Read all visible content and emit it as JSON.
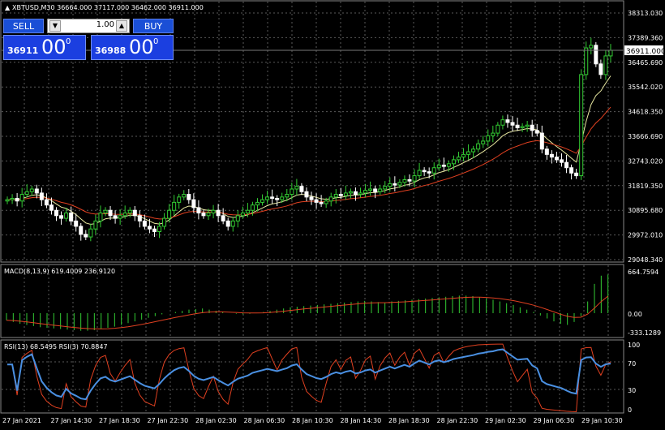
{
  "symbol_header": "XBTUSD,M30  36664.000 37117.000 36462.000 36911.000",
  "trade_panel": {
    "sell_label": "SELL",
    "buy_label": "BUY",
    "lot_value": "1.00",
    "sell_price_small": "36911",
    "sell_price_big": "00",
    "sell_price_sup": "0",
    "buy_price_small": "36988",
    "buy_price_big": "00",
    "buy_price_sup": "0"
  },
  "price_axis": [
    "38313.030",
    "37389.360",
    "36465.690",
    "35542.020",
    "34618.350",
    "33666.690",
    "32743.020",
    "31819.350",
    "30895.680",
    "29972.010",
    "29048.340"
  ],
  "current_price_label": "36911.000",
  "macd": {
    "header": "MACD(8,13,9) 619.4009 236.9120",
    "axis": [
      "664.7594",
      "0.00",
      "-333.1289"
    ]
  },
  "rsi": {
    "header": "RSI(13) 68.5495  RSI(3) 70.8847",
    "axis": [
      "100",
      "70",
      "30",
      "0"
    ]
  },
  "time_axis": [
    "27 Jan 2021",
    "27 Jan 14:30",
    "27 Jan 18:30",
    "27 Jan 22:30",
    "28 Jan 02:30",
    "28 Jan 06:30",
    "28 Jan 10:30",
    "28 Jan 14:30",
    "28 Jan 18:30",
    "28 Jan 22:30",
    "29 Jan 02:30",
    "29 Jan 06:30",
    "29 Jan 10:30"
  ],
  "colors": {
    "bull": "#33cc33",
    "bear": "#ffffff",
    "ma_fast": "#e8e8a0",
    "ma_slow": "#e04020",
    "macd_hist": "#33cc33",
    "macd_signal": "#e04020",
    "rsi_fast": "#e04020",
    "rsi_slow": "#4a90e2",
    "grid": "#5a5a5a"
  },
  "chart_data": {
    "type": "candlestick",
    "title": "XBTUSD,M30",
    "ylim": [
      29048.34,
      38313.03
    ],
    "close": [
      31300,
      31350,
      31250,
      31500,
      31600,
      31700,
      31550,
      31300,
      31100,
      30900,
      30700,
      30600,
      30800,
      30500,
      30300,
      30000,
      29900,
      30200,
      30500,
      30800,
      30900,
      30700,
      30600,
      30700,
      30800,
      30900,
      30700,
      30500,
      30300,
      30200,
      30100,
      30300,
      30600,
      30900,
      31200,
      31400,
      31500,
      31300,
      31000,
      30800,
      30700,
      30800,
      30900,
      30700,
      30500,
      30300,
      30500,
      30700,
      30800,
      30900,
      31100,
      31200,
      31300,
      31400,
      31350,
      31300,
      31400,
      31500,
      31700,
      31800,
      31600,
      31400,
      31300,
      31200,
      31150,
      31250,
      31400,
      31500,
      31450,
      31550,
      31600,
      31500,
      31550,
      31650,
      31700,
      31600,
      31700,
      31800,
      31900,
      31850,
      31950,
      32050,
      32000,
      32200,
      32400,
      32350,
      32300,
      32500,
      32600,
      32550,
      32650,
      32800,
      32900,
      33000,
      33100,
      33200,
      33400,
      33500,
      33700,
      33800,
      34100,
      34300,
      34200,
      34100,
      34000,
      34050,
      34100,
      33900,
      33800,
      33200,
      33000,
      32900,
      32800,
      32700,
      32500,
      32300,
      32200,
      36000,
      37000,
      37100,
      36400,
      36000,
      36700,
      36911
    ],
    "macd_hist": [
      -120,
      -150,
      -180,
      -200,
      -220,
      -240,
      -250,
      -260,
      -270,
      -280,
      -290,
      -300,
      -300,
      -290,
      -270,
      -250,
      -230,
      -200,
      -170,
      -140,
      -110,
      -80,
      -50,
      -20,
      0,
      20,
      40,
      60,
      70,
      80,
      60,
      40,
      20,
      0,
      -10,
      -20,
      -10,
      0,
      20,
      40,
      60,
      80,
      100,
      110,
      120,
      130,
      140,
      150,
      160,
      170,
      180,
      190,
      200,
      210,
      200,
      190,
      180,
      200,
      210,
      220,
      230,
      240,
      250,
      260,
      270,
      280,
      290,
      300,
      300,
      290,
      270,
      250,
      230,
      200,
      170,
      140,
      100,
      60,
      20,
      -40,
      -90,
      -140,
      -180,
      -200,
      -150,
      -50,
      200,
      500,
      640,
      660
    ]
  }
}
